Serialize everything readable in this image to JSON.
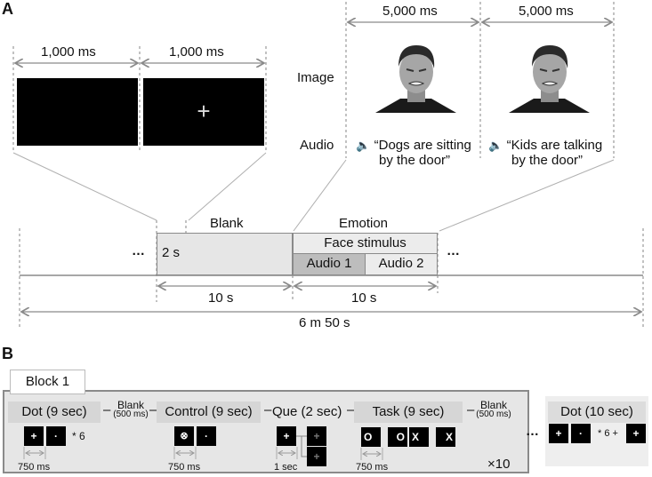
{
  "panel_a": {
    "label": "A",
    "durations": {
      "blank_screen": "1,000 ms",
      "fixation_screen": "1,000 ms",
      "image_1": "5,000 ms",
      "image_2": "5,000 ms"
    },
    "row_labels": {
      "image": "Image",
      "audio": "Audio"
    },
    "fixation_symbol": "+",
    "audio_icon": "speaker-icon",
    "audio_1": {
      "line1": "“Dogs are sitting",
      "line2": "by the door”"
    },
    "audio_2": {
      "line1": "“Kids are talking",
      "line2": "by the door”"
    },
    "timeline": {
      "ellipsis": "…",
      "blank_label": "Blank",
      "emotion_label": "Emotion",
      "face_stimulus": "Face stimulus",
      "audio1": "Audio 1",
      "audio2": "Audio 2",
      "onset_offset": "2 s",
      "blank_duration": "10 s",
      "emotion_duration": "10 s",
      "total_duration": "6 m 50 s"
    },
    "colors": {
      "blank_fill": "#e6e6e6",
      "face_fill": "#ececec",
      "audio1_fill": "#bdbdbd",
      "line": "#8a8a8a"
    }
  },
  "panel_b": {
    "label": "B",
    "block_title": "Block 1",
    "dash": "–",
    "phases": {
      "dot": "Dot (9 sec)",
      "blank1_top": "Blank",
      "blank1_bottom": "(500 ms)",
      "control": "Control (9 sec)",
      "que": "Que (2 sec)",
      "task": "Task (9 sec)",
      "blank2_top": "Blank",
      "blank2_bottom": "(500 ms)"
    },
    "dot_repeat": "* 6",
    "timings": {
      "dot": "750 ms",
      "control": "750 ms",
      "que": "1 sec",
      "task": "750 ms"
    },
    "symbols": {
      "plus": "+",
      "dot": "·",
      "circle": "O",
      "x": "X",
      "scrambled": "⊗"
    },
    "repeat_label": "×10",
    "ellipsis": "…",
    "final": {
      "title": "Dot (10 sec)",
      "repeat": "* 6 +"
    }
  }
}
